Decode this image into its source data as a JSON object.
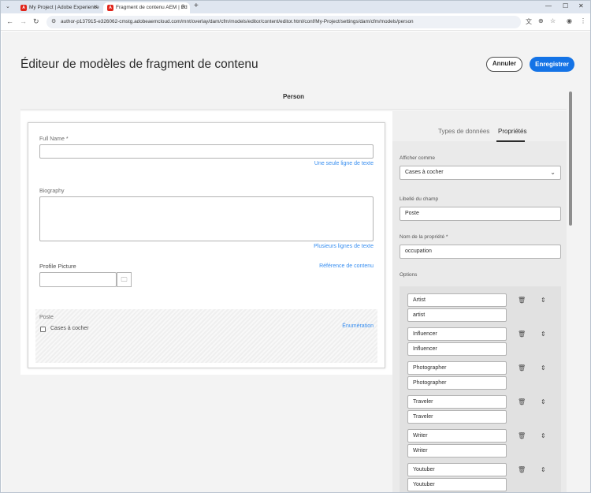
{
  "browser": {
    "tabs": [
      {
        "title": "My Project | Adobe Experience"
      },
      {
        "title": "Fragment de contenu AEM | Éd"
      }
    ],
    "new_tab": "+",
    "url": "author-p137915-e326062-cmstg.adobeaemcloud.com/mnt/overlay/dam/cfm/models/editor/content/editor.html/conf/My-Project/settings/dam/cfm/models/person"
  },
  "header": {
    "title": "Éditeur de modèles de fragment de contenu",
    "cancel_label": "Annuler",
    "save_label": "Enregistrer"
  },
  "model": {
    "name": "Person"
  },
  "fields": [
    {
      "label": "Full Name *",
      "type": "Une seule ligne de texte"
    },
    {
      "label": "Biography",
      "type": "Plusieurs lignes de texte"
    },
    {
      "label": "Profile Picture",
      "type": "Référence de contenu"
    },
    {
      "label": "Poste",
      "type": "Énumération",
      "option_label": "Cases à cocher"
    }
  ],
  "panel": {
    "tabs": [
      "Types de données",
      "Propriétés"
    ],
    "active_tab": "Propriétés",
    "render_as_label": "Afficher comme",
    "render_as_value": "Cases à cocher",
    "field_label_label": "Libellé du champ",
    "field_label_value": "Poste",
    "property_name_label": "Nom de la propriété *",
    "property_name_value": "occupation",
    "options_label": "Options",
    "options": [
      {
        "label": "Artist",
        "value": "artist"
      },
      {
        "label": "Influencer",
        "value": "Influencer"
      },
      {
        "label": "Photographer",
        "value": "Photographer"
      },
      {
        "label": "Traveler",
        "value": "Traveler"
      },
      {
        "label": "Writer",
        "value": "Writer"
      },
      {
        "label": "Youtuber",
        "value": "Youtuber"
      }
    ]
  },
  "colors": {
    "accent": "#1473e6",
    "link": "#378ef0"
  }
}
